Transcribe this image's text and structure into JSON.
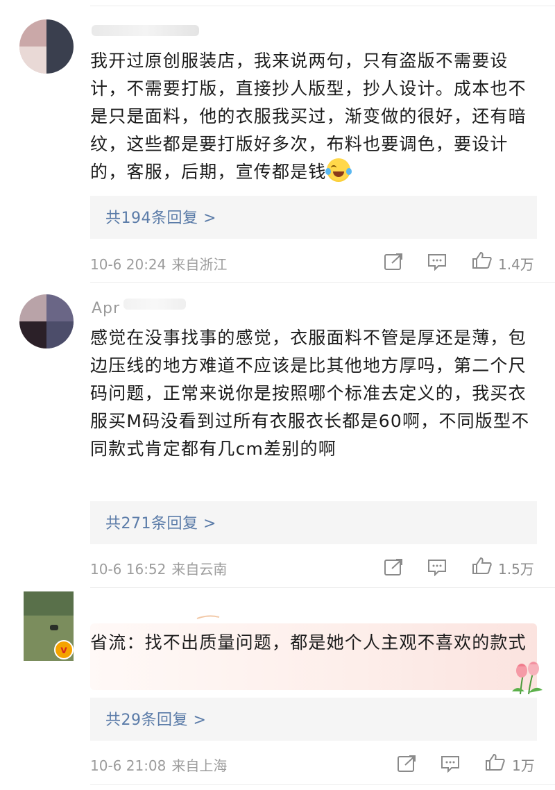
{
  "comments": [
    {
      "text": "我开过原创服装店，我来说两句，只有盗版不需要设计，不需要打版，直接抄人版型，抄人设计。成本也不是只是面料，他的衣服我买过，渐变做的很好，还有暗纹，这些都是要打版好多次，布料也要调色，要设计的，客服，后期，宣传都是钱",
      "replies": "共194条回复 >",
      "time": "10-6 20:24",
      "location": "来自浙江",
      "likes": "1.4万"
    },
    {
      "username": "Apr",
      "text": "感觉在没事找事的感觉，衣服面料不管是厚还是薄，包边压线的地方难道不应该是比其他地方厚吗，第二个尺码问题，正常来说你是按照哪个标准去定义的，我买衣服买M码没看到过所有衣服衣长都是60啊，不同版型不同款式肯定都有几cm差别的啊",
      "replies": "共271条回复 >",
      "time": "10-6 16:52",
      "location": "来自云南",
      "likes": "1.5万"
    },
    {
      "text": "省流：找不出质量问题，都是她个人主观不喜欢的款式",
      "replies": "共29条回复 >",
      "time": "10-6 21:08",
      "location": "来自上海",
      "likes": "1万",
      "badge": "v"
    }
  ],
  "icons": [
    "share-icon",
    "comment-icon",
    "like-icon"
  ],
  "colors": {
    "reply_link": "#5a7ba8",
    "meta": "#9c9c9c",
    "badge": "#f5a300"
  }
}
